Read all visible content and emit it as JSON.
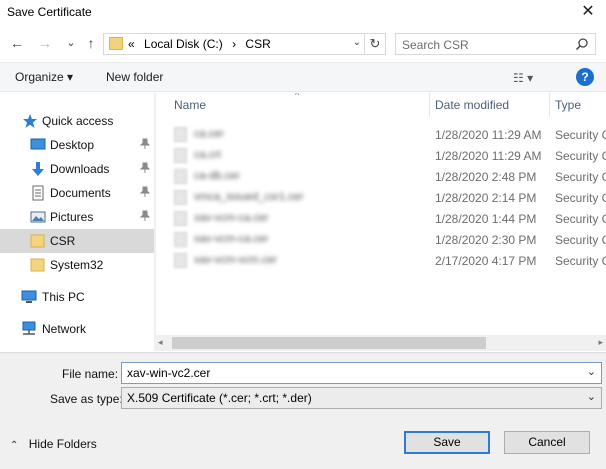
{
  "window": {
    "title": "Save Certificate",
    "close_glyph": "✕"
  },
  "nav": {
    "back_glyph": "←",
    "forward_glyph": "→",
    "recent_glyph": "⌄",
    "up_glyph": "↑",
    "address_prefix": "«",
    "breadcrumb": [
      "Local Disk (C:)",
      "›",
      "CSR"
    ],
    "address_dropdown_glyph": "⌄",
    "refresh_glyph": "↻",
    "search_placeholder": "Search CSR"
  },
  "toolbar": {
    "organize_label": "Organize ▾",
    "new_folder_label": "New folder",
    "view_glyph": "☷ ▾",
    "help_glyph": "?"
  },
  "sidebar": {
    "items": [
      {
        "label": "Quick access",
        "icon": "star-icon",
        "pinned": false
      },
      {
        "label": "Desktop",
        "icon": "desktop-icon",
        "pinned": true
      },
      {
        "label": "Downloads",
        "icon": "download-icon",
        "pinned": true
      },
      {
        "label": "Documents",
        "icon": "documents-icon",
        "pinned": true
      },
      {
        "label": "Pictures",
        "icon": "pictures-icon",
        "pinned": true
      },
      {
        "label": "CSR",
        "icon": "folder-icon",
        "pinned": false,
        "selected": true
      },
      {
        "label": "System32",
        "icon": "folder-icon",
        "pinned": false
      },
      {
        "label": "This PC",
        "icon": "computer-icon",
        "pinned": false
      },
      {
        "label": "Network",
        "icon": "network-icon",
        "pinned": false
      }
    ],
    "pin_glyph": "📌"
  },
  "filelist": {
    "columns": [
      "Name",
      "Date modified",
      "Type"
    ],
    "sort_glyph": "^",
    "rows": [
      {
        "name": "ca.cer",
        "date": "1/28/2020 11:29 AM",
        "type": "Security C"
      },
      {
        "name": "ca.crt",
        "date": "1/28/2020 11:29 AM",
        "type": "Security C"
      },
      {
        "name": "ca-db.cer",
        "date": "1/28/2020 2:48 PM",
        "type": "Security C"
      },
      {
        "name": "vmca_issued_csr1.cer",
        "date": "1/28/2020 2:14 PM",
        "type": "Security C"
      },
      {
        "name": "xav-vcm-ca.cer",
        "date": "1/28/2020 1:44 PM",
        "type": "Security C"
      },
      {
        "name": "xav-vcm-ca.cer",
        "date": "1/28/2020 2:30 PM",
        "type": "Security C"
      },
      {
        "name": "xav-vcm-vcm.cer",
        "date": "2/17/2020 4:17 PM",
        "type": "Security C"
      }
    ],
    "scroll_left_glyph": "◂",
    "scroll_right_glyph": "▸"
  },
  "form": {
    "filename_label": "File name:",
    "filename_value": "xav-win-vc2.cer",
    "savetype_label": "Save as type:",
    "savetype_value": "X.509 Certificate (*.cer; *.crt; *.der)",
    "chevron_glyph": "⌄",
    "hide_folders_caret": "⌃",
    "hide_folders_label": "Hide Folders",
    "save_label": "Save",
    "cancel_label": "Cancel"
  }
}
